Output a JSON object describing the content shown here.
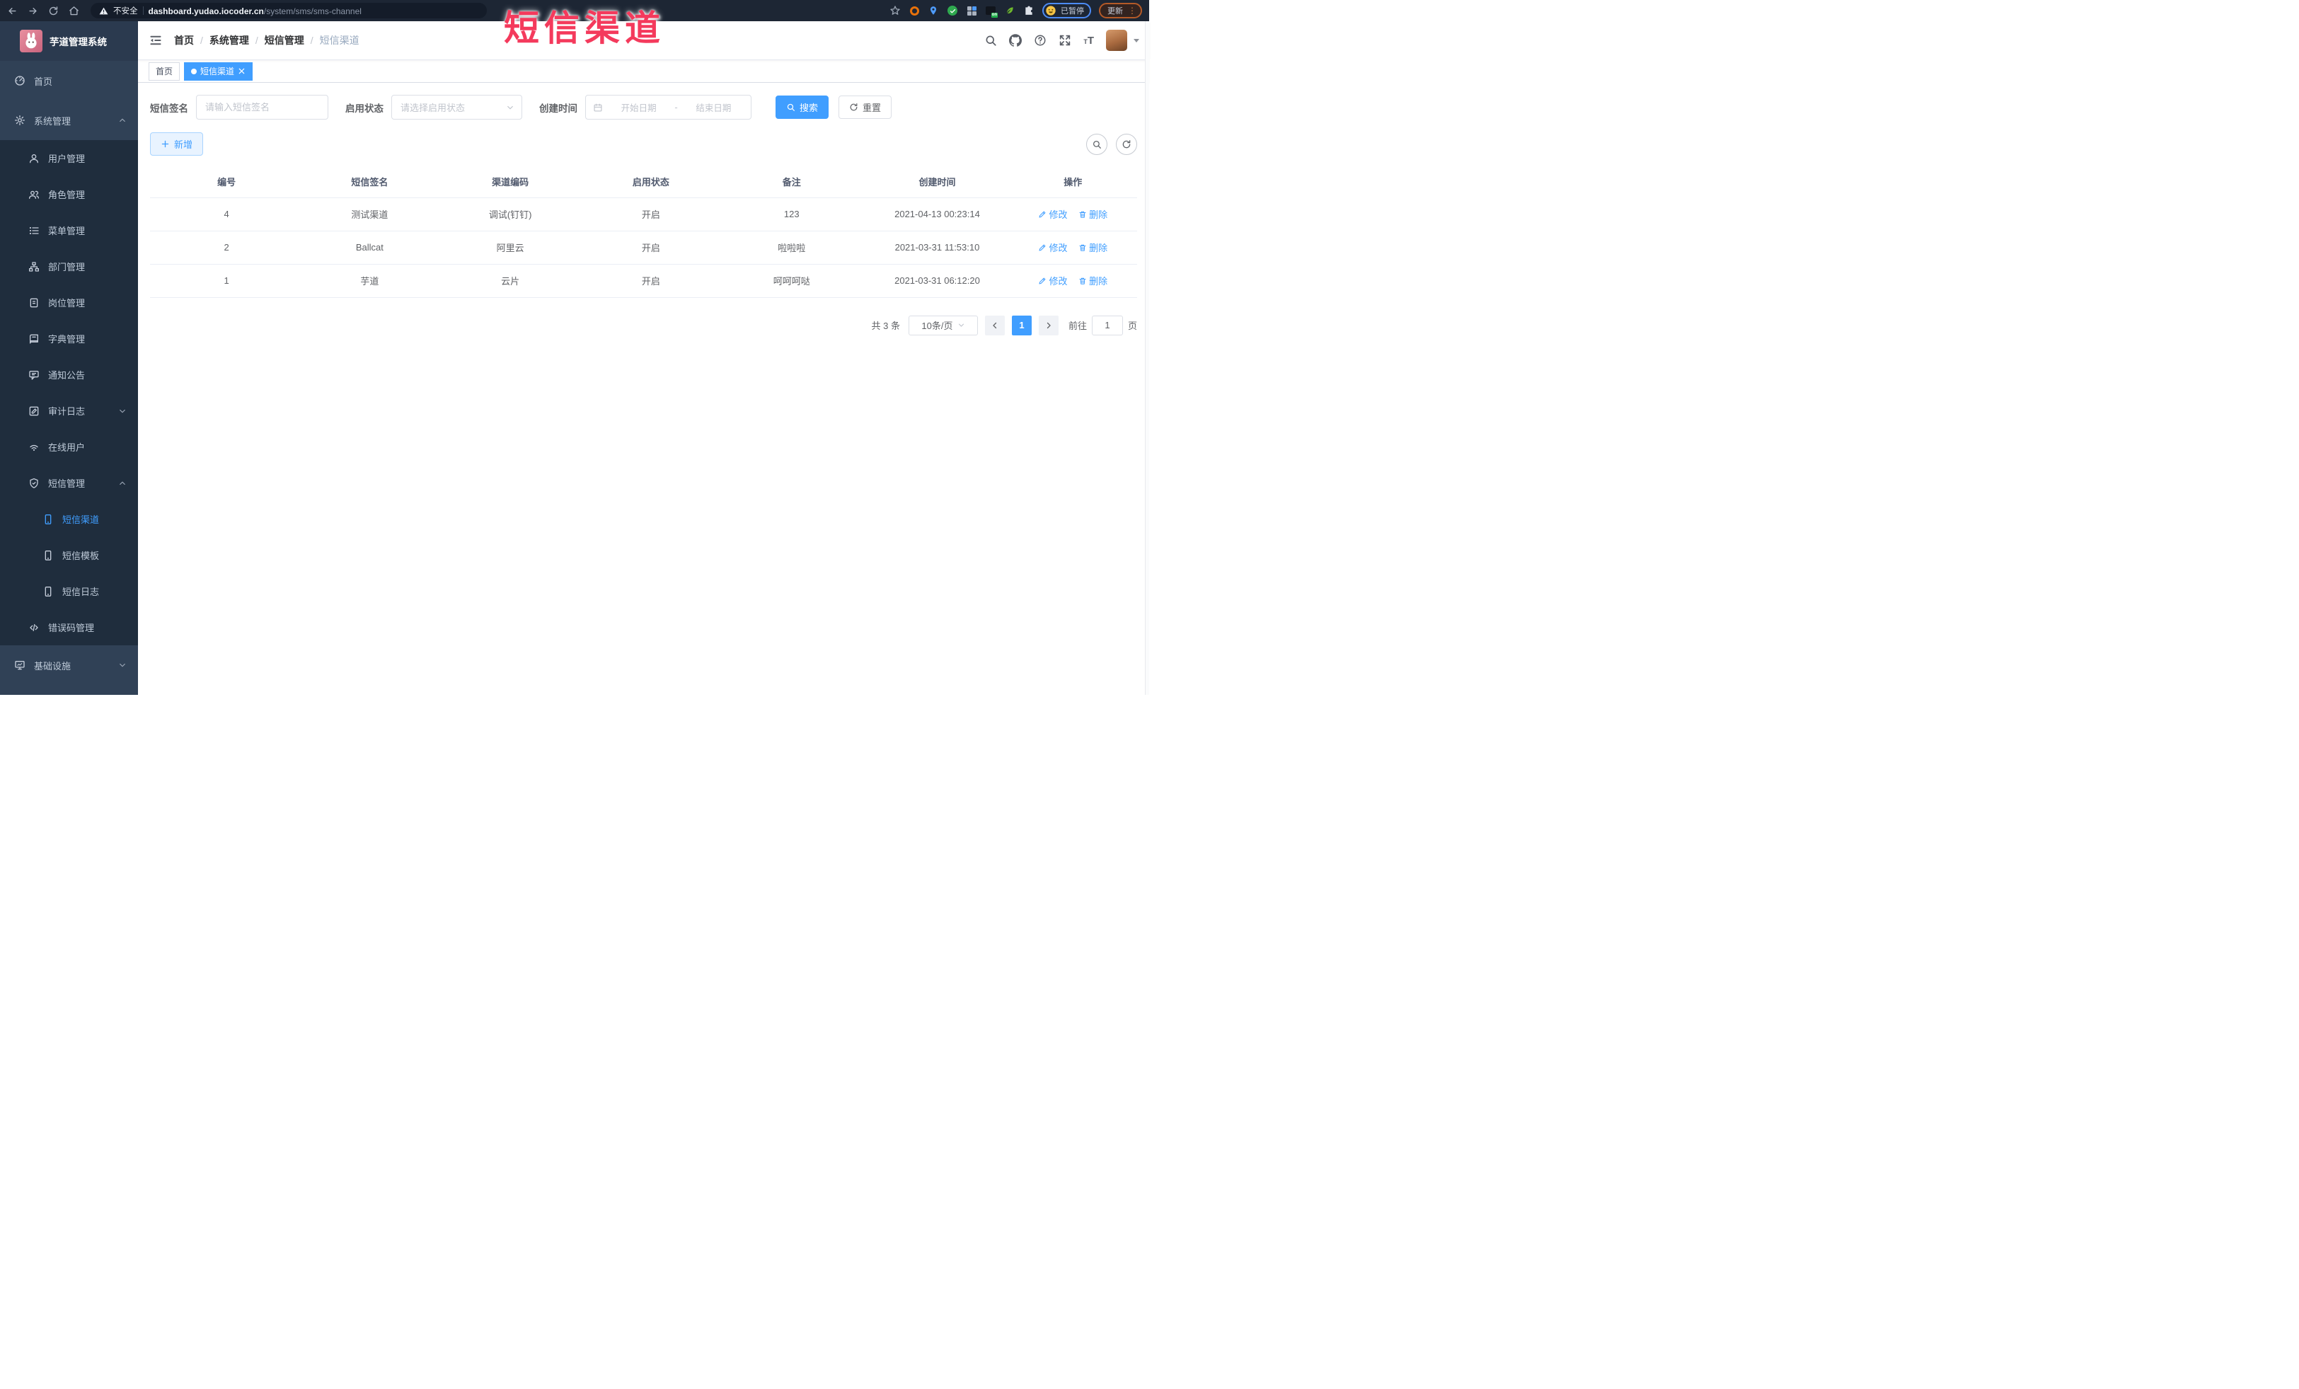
{
  "browser": {
    "security_warning": "不安全",
    "url_host": "dashboard.yudao.iocoder.cn",
    "url_path": "/system/sms/sms-channel",
    "paused_badge": "已暂停",
    "update_button": "更新"
  },
  "overlay_title": "短信渠道",
  "sidebar": {
    "logo_title": "芋道管理系统",
    "items": [
      {
        "label": "首页"
      },
      {
        "label": "系统管理"
      },
      {
        "label": "用户管理"
      },
      {
        "label": "角色管理"
      },
      {
        "label": "菜单管理"
      },
      {
        "label": "部门管理"
      },
      {
        "label": "岗位管理"
      },
      {
        "label": "字典管理"
      },
      {
        "label": "通知公告"
      },
      {
        "label": "审计日志"
      },
      {
        "label": "在线用户"
      },
      {
        "label": "短信管理"
      },
      {
        "label": "短信渠道"
      },
      {
        "label": "短信模板"
      },
      {
        "label": "短信日志"
      },
      {
        "label": "错误码管理"
      },
      {
        "label": "基础设施"
      }
    ]
  },
  "breadcrumb": {
    "separator": "/",
    "items": [
      "首页",
      "系统管理",
      "短信管理",
      "短信渠道"
    ]
  },
  "tabs": [
    {
      "label": "首页"
    },
    {
      "label": "短信渠道"
    }
  ],
  "filters": {
    "sign_label": "短信签名",
    "sign_placeholder": "请输入短信签名",
    "status_label": "启用状态",
    "status_placeholder": "请选择启用状态",
    "time_label": "创建时间",
    "start_placeholder": "开始日期",
    "range_separator": "-",
    "end_placeholder": "结束日期",
    "search_button": "搜索",
    "reset_button": "重置"
  },
  "toolbar": {
    "add_button": "新增"
  },
  "table": {
    "headers": [
      "编号",
      "短信签名",
      "渠道编码",
      "启用状态",
      "备注",
      "创建时间",
      "操作"
    ],
    "rows": [
      {
        "id": "4",
        "sign": "测试渠道",
        "code": "调试(钉钉)",
        "status": "开启",
        "remark": "123",
        "created": "2021-04-13 00:23:14"
      },
      {
        "id": "2",
        "sign": "Ballcat",
        "code": "阿里云",
        "status": "开启",
        "remark": "啦啦啦",
        "created": "2021-03-31 11:53:10"
      },
      {
        "id": "1",
        "sign": "芋道",
        "code": "云片",
        "status": "开启",
        "remark": "呵呵呵哒",
        "created": "2021-03-31 06:12:20"
      }
    ],
    "edit_label": "修改",
    "delete_label": "删除"
  },
  "pagination": {
    "total_text": "共 3 条",
    "page_size": "10条/页",
    "current_page": "1",
    "goto_label": "前往",
    "goto_value": "1",
    "page_unit": "页"
  },
  "colors": {
    "accent": "#409eff",
    "sidebar_bg": "#304156",
    "submenu_bg": "#1f2d3d",
    "overlay_red": "#f43a5c"
  }
}
